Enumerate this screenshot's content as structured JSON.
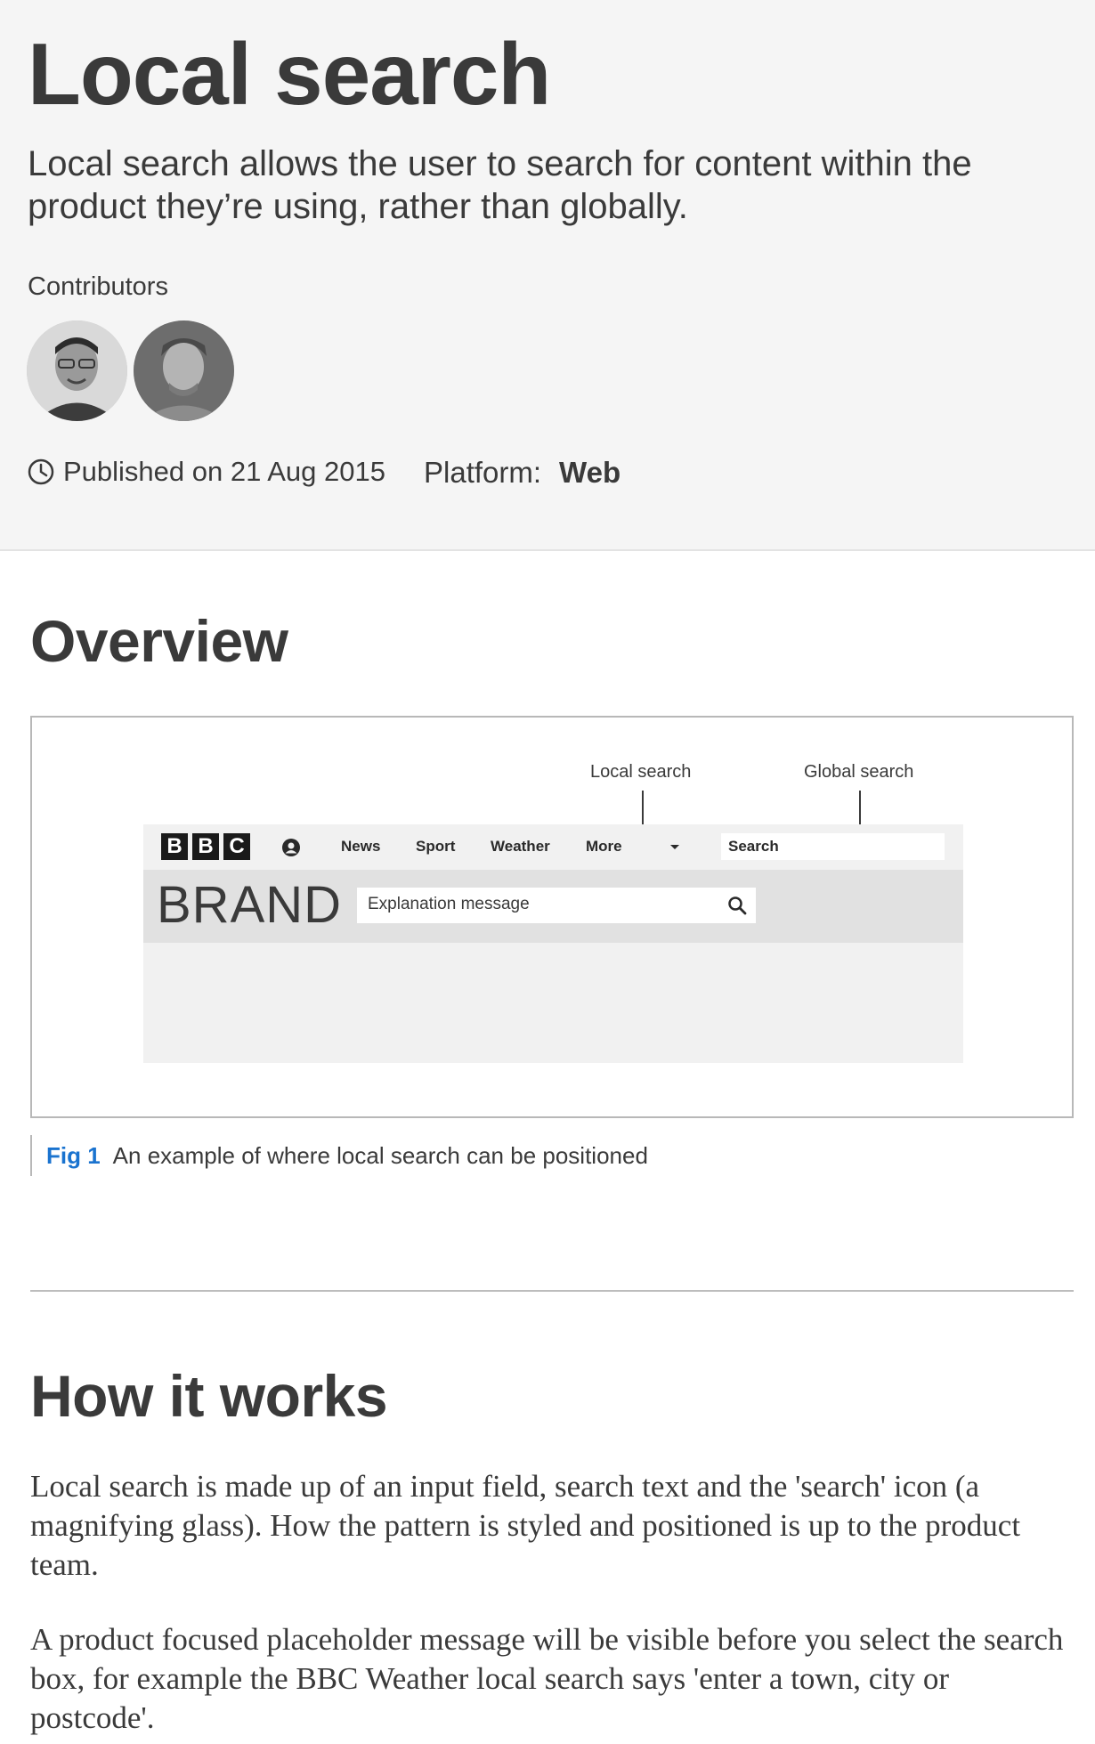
{
  "header": {
    "title": "Local search",
    "intro": "Local search allows the user to search for content within the product they’re using, rather than globally.",
    "contributors_label": "Contributors",
    "published": "Published on 21 Aug 2015",
    "platform_label": "Platform:",
    "platform_value": "Web"
  },
  "overview": {
    "heading": "Overview",
    "figure": {
      "callout_local": "Local search",
      "callout_global": "Global search",
      "logo_letters": [
        "B",
        "B",
        "C"
      ],
      "nav": [
        "News",
        "Sport",
        "Weather",
        "More"
      ],
      "global_search_text": "Search",
      "brand": "BRAND",
      "local_search_placeholder": "Explanation message"
    },
    "caption_num": "Fig 1",
    "caption_text": "An example of where local search can be positioned"
  },
  "how_it_works": {
    "heading": "How it works",
    "paragraphs": [
      "Local search is made up of an input field, search text and the 'search' icon (a magnifying glass). How the pattern is styled and positioned is up to the product team.",
      "A product focused placeholder message will be visible before you select the search box, for example the BBC Weather local search says 'enter a town, city or postcode'."
    ]
  },
  "icons": {
    "clock": "clock-icon",
    "user": "user-icon",
    "search": "search-icon",
    "caret": "chevron-down-icon"
  },
  "colors": {
    "header_bg": "#f5f5f5",
    "text": "#3a3a3a",
    "fig_accent": "#1a73cf"
  }
}
